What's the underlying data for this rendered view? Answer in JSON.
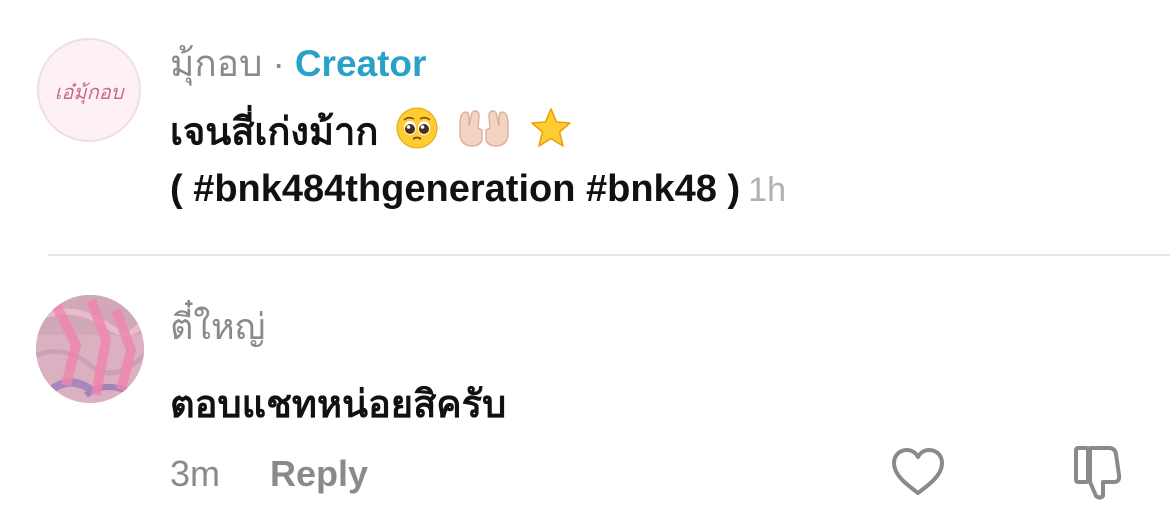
{
  "creator_comment": {
    "author": "มุ้กอบ",
    "separator": "·",
    "badge": "Creator",
    "avatar_text": "เอ๋มุ้กอบ",
    "text_line1": "เจนสี่เก่งม้าก",
    "emojis": [
      "pleading-face",
      "palms-up-together",
      "star"
    ],
    "text_line2": "( #bnk484thgeneration #bnk48 )",
    "time": "1h"
  },
  "reply_comment": {
    "author": "ตี๋ใหญ่",
    "text": "ตอบแชทหน่อยสิครับ",
    "time": "3m",
    "reply_label": "Reply"
  },
  "icons": {
    "like": "heart-icon",
    "dislike": "thumbs-down-icon"
  },
  "colors": {
    "creator_badge": "#2aa2c8",
    "muted_text": "#8a8a8a",
    "timestamp": "#b0b0b0",
    "divider": "#e6e6e6"
  }
}
